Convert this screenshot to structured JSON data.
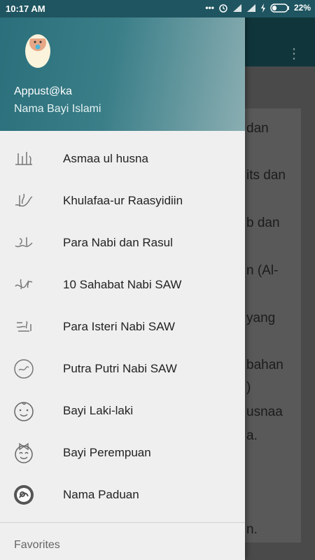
{
  "status_bar": {
    "time": "10:17 AM",
    "battery": "22%"
  },
  "background_partial_text": [
    "dan",
    "its dan",
    "b dan",
    "n (Al-",
    "yang",
    "bahan",
    ")",
    "usnaa",
    "a.",
    "n."
  ],
  "drawer": {
    "app_name": "Appust@ka",
    "app_subtitle": "Nama Bayi Islami",
    "items": [
      {
        "label": "Asmaa ul husna",
        "icon": "calligraphy-icon"
      },
      {
        "label": "Khulafaa-ur Raasyidiin",
        "icon": "calligraphy-icon"
      },
      {
        "label": "Para Nabi dan Rasul",
        "icon": "calligraphy-icon"
      },
      {
        "label": "10 Sahabat Nabi SAW",
        "icon": "calligraphy-icon"
      },
      {
        "label": "Para Isteri Nabi SAW",
        "icon": "calligraphy-icon"
      },
      {
        "label": "Putra Putri Nabi SAW",
        "icon": "calligraphy-icon"
      },
      {
        "label": "Bayi Laki-laki",
        "icon": "baby-boy-icon"
      },
      {
        "label": "Bayi Perempuan",
        "icon": "baby-girl-icon"
      },
      {
        "label": "Nama Paduan",
        "icon": "baby-face-icon"
      }
    ],
    "section_title": "Favorites"
  }
}
